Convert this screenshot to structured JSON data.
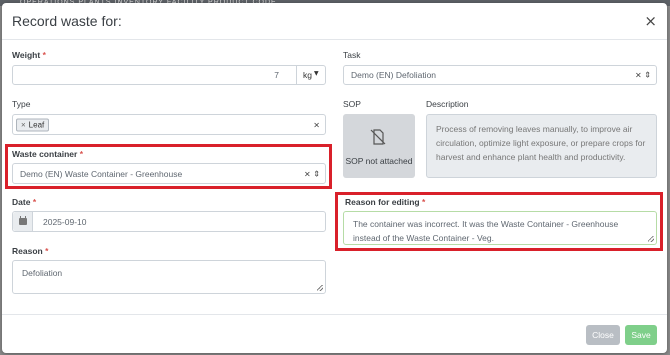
{
  "background": {
    "strip_text": "OPERATIONS   PLANTS   INVENTORY   FACILITY   PRODUCT CODE"
  },
  "modal": {
    "title": "Record waste for:",
    "close_glyph": "×"
  },
  "weight": {
    "label": "Weight",
    "value": "7",
    "unit": "kg"
  },
  "task": {
    "label": "Task",
    "value": "Demo (EN) Defoliation"
  },
  "type": {
    "label": "Type",
    "tag": "Leaf"
  },
  "sop": {
    "label": "SOP",
    "status": "SOP not attached"
  },
  "description": {
    "label": "Description",
    "text": "Process of removing leaves manually, to improve air circulation, optimize light exposure, or prepare crops for harvest and enhance plant health and productivity."
  },
  "waste_container": {
    "label": "Waste container",
    "value": "Demo (EN) Waste Container - Greenhouse"
  },
  "reason_for_editing": {
    "label": "Reason for editing",
    "text": "The container was incorrect. It was the Waste Container - Greenhouse instead of the Waste Container - Veg."
  },
  "date": {
    "label": "Date",
    "value": "2025-09-10"
  },
  "reason": {
    "label": "Reason",
    "text": "Defoliation"
  },
  "footer": {
    "close_label": "Close",
    "save_label": "Save"
  },
  "colors": {
    "highlight": "#d9202a",
    "required": "#d9534f",
    "save_button": "#7fcf8a",
    "close_button": "#b9bec4",
    "reason_editing_border": "#b6dca6"
  },
  "icons": {
    "dropdown": "chevron-down-icon",
    "clear": "clear-icon",
    "calendar": "calendar-icon",
    "sop": "file-slash-icon",
    "resize": "resize-grip-icon"
  }
}
